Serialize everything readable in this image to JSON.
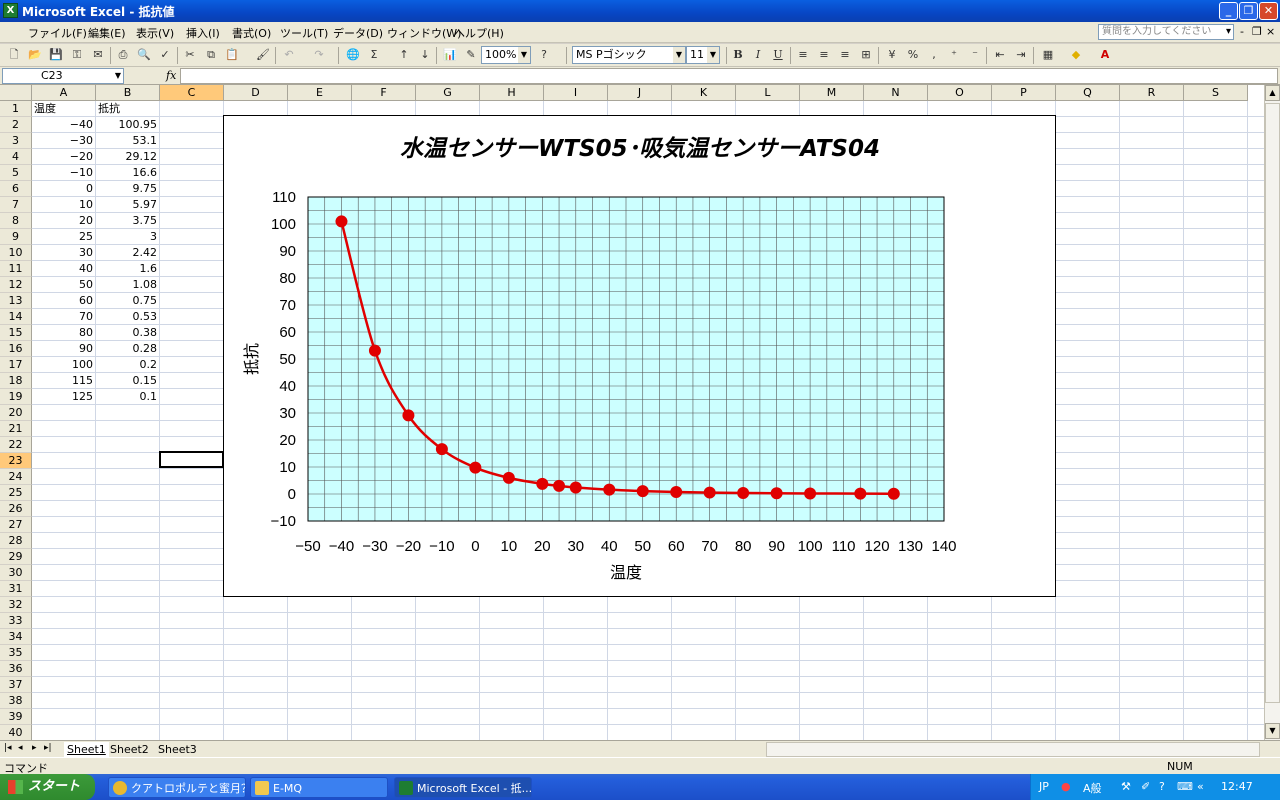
{
  "window": {
    "title": "Microsoft Excel - 抵抗値",
    "icon": "excel-icon",
    "controls": [
      "_",
      "❐",
      "✕"
    ]
  },
  "menu": {
    "items": [
      "ファイル(F)",
      "編集(E)",
      "表示(V)",
      "挿入(I)",
      "書式(O)",
      "ツール(T)",
      "データ(D)",
      "ウィンドウ(W)",
      "ヘルプ(H)"
    ],
    "help_placeholder": "質問を入力してください",
    "doc_controls": [
      "-",
      "❐",
      "×"
    ]
  },
  "toolbar": {
    "zoom": "100%",
    "font": "MS Pゴシック",
    "font_size": "11",
    "bold": "B",
    "italic": "I",
    "underline": "U",
    "autosum": "Σ",
    "percent": "%",
    "comma": ","
  },
  "formula_bar": {
    "name_box": "C23",
    "fx": "fx",
    "formula": ""
  },
  "grid": {
    "columns": [
      "A",
      "B",
      "C",
      "D",
      "E",
      "F",
      "G",
      "H",
      "I",
      "J",
      "K",
      "L",
      "M",
      "N",
      "O",
      "P",
      "Q",
      "R",
      "S"
    ],
    "active_column": "C",
    "active_row": 23,
    "row_count": 40,
    "header_row": [
      "温度",
      "抵抗"
    ],
    "rows": [
      [
        "-40",
        "100.95"
      ],
      [
        "-30",
        "53.1"
      ],
      [
        "-20",
        "29.12"
      ],
      [
        "-10",
        "16.6"
      ],
      [
        "0",
        "9.75"
      ],
      [
        "10",
        "5.97"
      ],
      [
        "20",
        "3.75"
      ],
      [
        "25",
        "3"
      ],
      [
        "30",
        "2.42"
      ],
      [
        "40",
        "1.6"
      ],
      [
        "50",
        "1.08"
      ],
      [
        "60",
        "0.75"
      ],
      [
        "70",
        "0.53"
      ],
      [
        "80",
        "0.38"
      ],
      [
        "90",
        "0.28"
      ],
      [
        "100",
        "0.2"
      ],
      [
        "115",
        "0.15"
      ],
      [
        "125",
        "0.1"
      ]
    ]
  },
  "chart_data": {
    "type": "scatter",
    "title": "水温センサーWTS05･吸気温センサーATS04",
    "xlabel": "温度",
    "ylabel": "抵抗",
    "xlim": [
      -50,
      140
    ],
    "ylim": [
      -10,
      110
    ],
    "x_ticks": [
      -50,
      -40,
      -30,
      -20,
      -10,
      0,
      10,
      20,
      30,
      40,
      50,
      60,
      70,
      80,
      90,
      100,
      110,
      120,
      130,
      140
    ],
    "y_ticks": [
      -10,
      0,
      10,
      20,
      30,
      40,
      50,
      60,
      70,
      80,
      90,
      100,
      110
    ],
    "grid": true,
    "plot_background": "#ccffff",
    "line_color": "#e00000",
    "smooth_line": true,
    "series": [
      {
        "x": [
          -40,
          -30,
          -20,
          -10,
          0,
          10,
          20,
          25,
          30,
          40,
          50,
          60,
          70,
          80,
          90,
          100,
          115,
          125
        ],
        "y": [
          100.95,
          53.1,
          29.12,
          16.6,
          9.75,
          5.97,
          3.75,
          3,
          2.42,
          1.6,
          1.08,
          0.75,
          0.53,
          0.38,
          0.28,
          0.2,
          0.15,
          0.1
        ]
      }
    ]
  },
  "sheets": {
    "nav": [
      "|◂",
      "◂",
      "▸",
      "▸|"
    ],
    "tabs": [
      "Sheet1",
      "Sheet2",
      "Sheet3"
    ],
    "active": "Sheet1"
  },
  "status": {
    "text": "コマンド",
    "num": "NUM"
  },
  "taskbar": {
    "start": "スタート",
    "tasks": [
      {
        "label": "クアトロポルテと蜜月？...",
        "icon": "chrome-icon",
        "color": "#e8b830"
      },
      {
        "label": "E-MQ",
        "icon": "folder-icon",
        "color": "#f0c850"
      },
      {
        "label": "Microsoft Excel - 抵...",
        "icon": "excel-icon",
        "color": "#1e7d32"
      }
    ],
    "tray": {
      "lang": "JP",
      "ime": "A般",
      "clock": "12:47"
    }
  }
}
